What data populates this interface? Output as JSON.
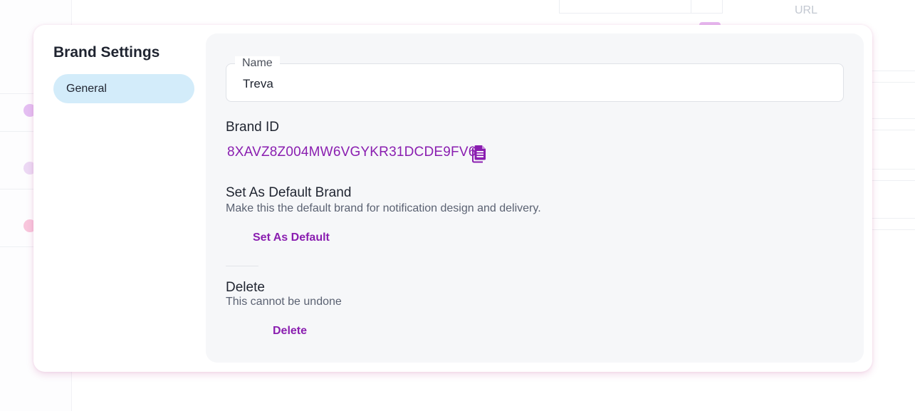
{
  "background": {
    "url_column_label": "URL"
  },
  "modal": {
    "title": "Brand Settings",
    "nav": [
      {
        "label": "General",
        "selected": true
      }
    ],
    "name_field": {
      "label": "Name",
      "value": "Treva"
    },
    "brand_id": {
      "heading": "Brand ID",
      "value": "8XAVZ8Z004MW6VGYKR31DCDE9FV6",
      "copy_icon": "copy-document-icon"
    },
    "default_brand": {
      "heading": "Set As Default Brand",
      "description": "Make this the default brand for notification design and delivery.",
      "button_label": "Set As Default"
    },
    "delete_section": {
      "heading": "Delete",
      "description": "This cannot be undone",
      "button_label": "Delete"
    }
  },
  "colors": {
    "accent": "#8a1eb0",
    "nav_selected": "#d3ecfa",
    "content_bg": "#f6f7f9"
  }
}
